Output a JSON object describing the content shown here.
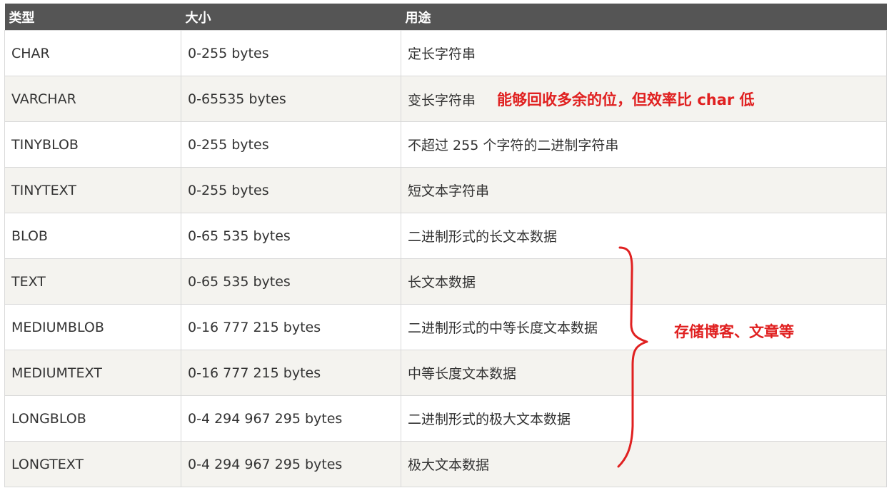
{
  "table": {
    "headers": [
      "类型",
      "大小",
      "用途"
    ],
    "rows": [
      {
        "type": "CHAR",
        "size": "0-255 bytes",
        "use": "定长字符串"
      },
      {
        "type": "VARCHAR",
        "size": "0-65535 bytes",
        "use": "变长字符串"
      },
      {
        "type": "TINYBLOB",
        "size": "0-255 bytes",
        "use": "不超过 255 个字符的二进制字符串"
      },
      {
        "type": "TINYTEXT",
        "size": "0-255 bytes",
        "use": "短文本字符串"
      },
      {
        "type": "BLOB",
        "size": "0-65 535 bytes",
        "use": "二进制形式的长文本数据"
      },
      {
        "type": "TEXT",
        "size": "0-65 535 bytes",
        "use": "长文本数据"
      },
      {
        "type": "MEDIUMBLOB",
        "size": "0-16 777 215 bytes",
        "use": "二进制形式的中等长度文本数据"
      },
      {
        "type": "MEDIUMTEXT",
        "size": "0-16 777 215 bytes",
        "use": "中等长度文本数据"
      },
      {
        "type": "LONGBLOB",
        "size": "0-4 294 967 295 bytes",
        "use": "二进制形式的极大文本数据"
      },
      {
        "type": "LONGTEXT",
        "size": "0-4 294 967 295 bytes",
        "use": "极大文本数据"
      }
    ]
  },
  "annotations": {
    "varchar_note": "能够回收多余的位，但效率比 char 低",
    "brace_note": "存储博客、文章等",
    "color": "#e02020"
  }
}
